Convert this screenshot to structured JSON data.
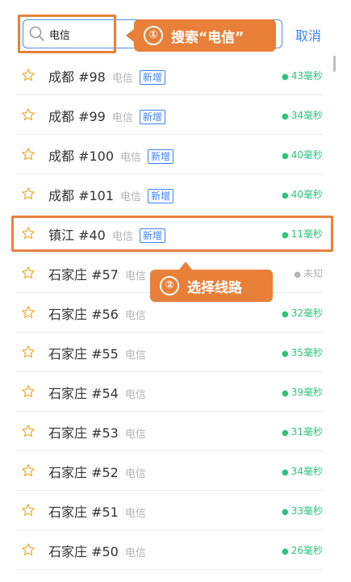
{
  "search": {
    "value": "电信",
    "placeholder": ""
  },
  "cancel_label": "取消",
  "callouts": {
    "step1_num": "①",
    "step1_text": "搜索“电信”",
    "step2_num": "②",
    "step2_text": "选择线路"
  },
  "servers": [
    {
      "name": "成都 #98",
      "isp": "电信",
      "tag": "新增",
      "latency": "43毫秒"
    },
    {
      "name": "成都 #99",
      "isp": "电信",
      "tag": "新增",
      "latency": "34毫秒"
    },
    {
      "name": "成都 #100",
      "isp": "电信",
      "tag": "新增",
      "latency": "40毫秒"
    },
    {
      "name": "成都 #101",
      "isp": "电信",
      "tag": "新增",
      "latency": "40毫秒"
    },
    {
      "name": "镇江 #40",
      "isp": "电信",
      "tag": "新增",
      "latency": "11毫秒"
    },
    {
      "name": "石家庄 #57",
      "isp": "电信",
      "tag": "",
      "latency": "未知"
    },
    {
      "name": "石家庄 #56",
      "isp": "电信",
      "tag": "",
      "latency": "32毫秒"
    },
    {
      "name": "石家庄 #55",
      "isp": "电信",
      "tag": "",
      "latency": "35毫秒"
    },
    {
      "name": "石家庄 #54",
      "isp": "电信",
      "tag": "",
      "latency": "39毫秒"
    },
    {
      "name": "石家庄 #53",
      "isp": "电信",
      "tag": "",
      "latency": "31毫秒"
    },
    {
      "name": "石家庄 #52",
      "isp": "电信",
      "tag": "",
      "latency": "34毫秒"
    },
    {
      "name": "石家庄 #51",
      "isp": "电信",
      "tag": "",
      "latency": "33毫秒"
    },
    {
      "name": "石家庄 #50",
      "isp": "电信",
      "tag": "",
      "latency": "26毫秒"
    }
  ],
  "colors": {
    "accent": "#3b82f6",
    "highlight": "#e8803a",
    "good": "#2ec27e",
    "star": "#f5a623"
  }
}
